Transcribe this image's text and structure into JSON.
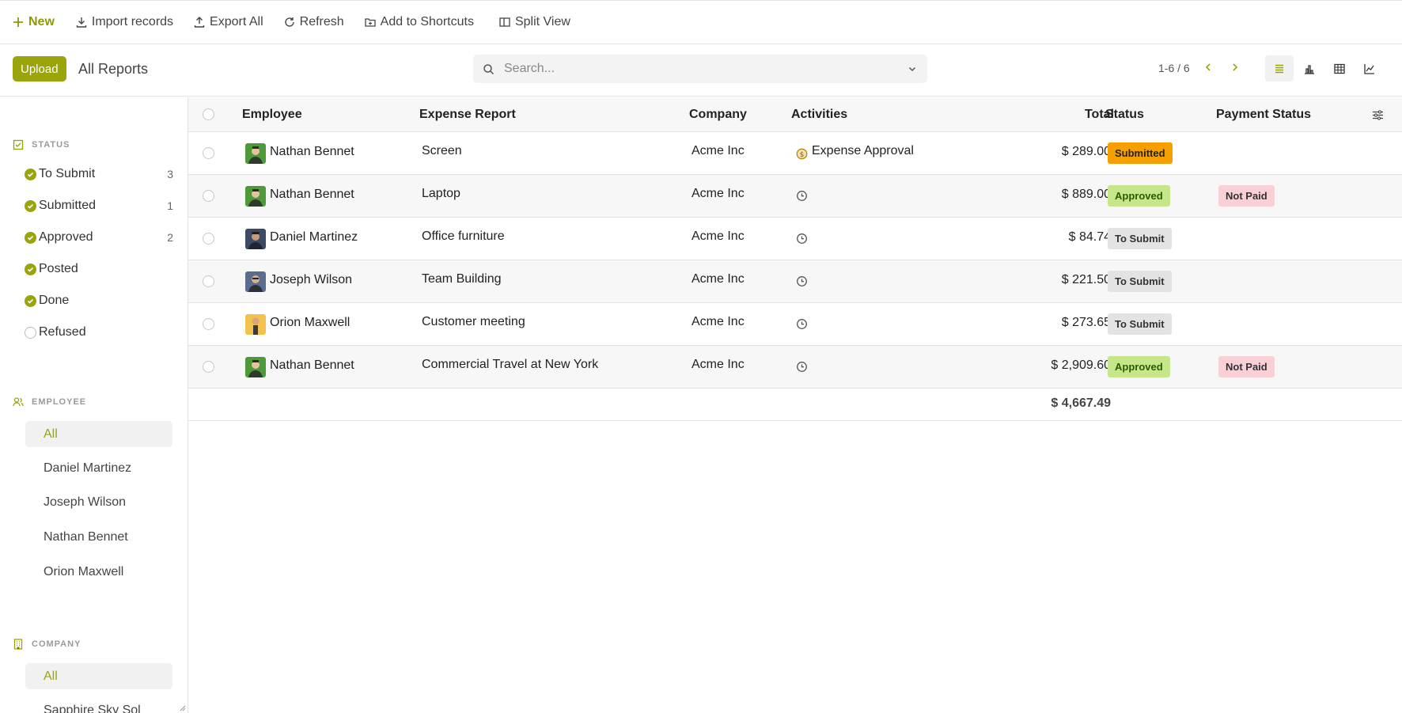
{
  "toolbar": {
    "new_label": "New",
    "import_label": "Import records",
    "export_label": "Export All",
    "refresh_label": "Refresh",
    "shortcuts_label": "Add to Shortcuts",
    "split_label": "Split View"
  },
  "header": {
    "upload_label": "Upload",
    "title": "All Reports",
    "search_placeholder": "Search...",
    "pager": "1-6 / 6"
  },
  "sidebar": {
    "status_title": "STATUS",
    "status_items": [
      {
        "label": "To Submit",
        "count": "3",
        "checked": true
      },
      {
        "label": "Submitted",
        "count": "1",
        "checked": true
      },
      {
        "label": "Approved",
        "count": "2",
        "checked": true
      },
      {
        "label": "Posted",
        "count": "",
        "checked": true
      },
      {
        "label": "Done",
        "count": "",
        "checked": true
      },
      {
        "label": "Refused",
        "count": "",
        "checked": false
      }
    ],
    "employee_title": "EMPLOYEE",
    "employee_items": [
      "All",
      "Daniel Martinez",
      "Joseph Wilson",
      "Nathan Bennet",
      "Orion Maxwell"
    ],
    "company_title": "COMPANY",
    "company_items": [
      "All",
      "Sapphire Sky Sol"
    ]
  },
  "table": {
    "columns": {
      "employee": "Employee",
      "report": "Expense Report",
      "company": "Company",
      "activities": "Activities",
      "total": "Total",
      "status": "Status",
      "payment": "Payment Status"
    },
    "rows": [
      {
        "employee": "Nathan Bennet",
        "report": "Screen",
        "company": "Acme Inc",
        "activity": "Expense Approval",
        "total": "$ 289.00",
        "status": "Submitted",
        "payment": ""
      },
      {
        "employee": "Nathan Bennet",
        "report": "Laptop",
        "company": "Acme Inc",
        "activity": "",
        "total": "$ 889.00",
        "status": "Approved",
        "payment": "Not Paid"
      },
      {
        "employee": "Daniel Martinez",
        "report": "Office furniture",
        "company": "Acme Inc",
        "activity": "",
        "total": "$ 84.74",
        "status": "To Submit",
        "payment": ""
      },
      {
        "employee": "Joseph Wilson",
        "report": "Team Building",
        "company": "Acme Inc",
        "activity": "",
        "total": "$ 221.50",
        "status": "To Submit",
        "payment": ""
      },
      {
        "employee": "Orion Maxwell",
        "report": "Customer meeting",
        "company": "Acme Inc",
        "activity": "",
        "total": "$ 273.65",
        "status": "To Submit",
        "payment": ""
      },
      {
        "employee": "Nathan Bennet",
        "report": "Commercial Travel at New York",
        "company": "Acme Inc",
        "activity": "",
        "total": "$ 2,909.60",
        "status": "Approved",
        "payment": "Not Paid"
      }
    ],
    "grand_total": "$ 4,667.49"
  },
  "colors": {
    "accent": "#9aa50b",
    "submitted": "#f5a000",
    "approved": "#c6e68a",
    "to_submit": "#e3e3e3",
    "not_paid": "#f8d0d6"
  }
}
